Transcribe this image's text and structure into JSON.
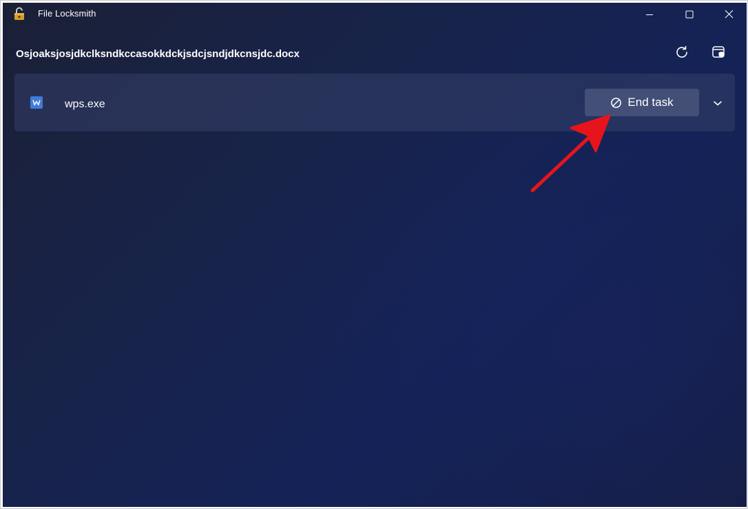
{
  "window": {
    "title": "File Locksmith",
    "app_icon": "padlock-icon",
    "controls": [
      "minimize-icon",
      "maximize-icon",
      "close-icon"
    ]
  },
  "header": {
    "file_name": "Osjoaksjosjdkclksndkccasokkdckjsdcjsndjdkcnsjdc.docx",
    "refresh_icon": "refresh-icon",
    "admin_icon": "shield-window-icon"
  },
  "processes": [
    {
      "name": "wps.exe",
      "icon": "wps-app-icon",
      "end_task_label": "End task",
      "end_task_icon": "prohibited-icon",
      "expand_icon": "chevron-down-icon"
    }
  ],
  "annotation": {
    "arrow_color": "#e8141b",
    "points_to": "end-task-button"
  },
  "colors": {
    "background": "#18234a",
    "row": "#2f3a60",
    "button": "#4e5a7e",
    "wps_blue": "#3f7bd9",
    "lock_orange": "#d99a2b"
  }
}
